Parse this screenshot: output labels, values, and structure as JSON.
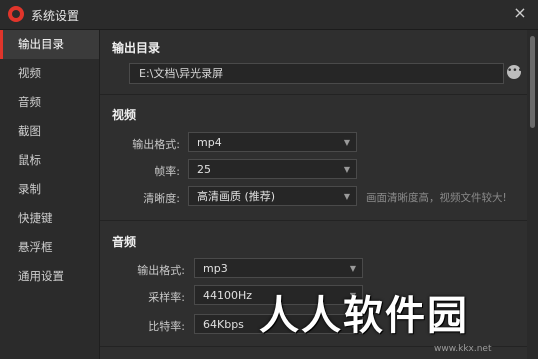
{
  "window": {
    "title": "系统设置",
    "close_icon": "×"
  },
  "sidebar": {
    "items": [
      {
        "label": "输出目录"
      },
      {
        "label": "视频"
      },
      {
        "label": "音频"
      },
      {
        "label": "截图"
      },
      {
        "label": "鼠标"
      },
      {
        "label": "录制"
      },
      {
        "label": "快捷键"
      },
      {
        "label": "悬浮框"
      },
      {
        "label": "通用设置"
      }
    ]
  },
  "output_dir": {
    "title": "输出目录",
    "path": "E:\\文档\\异光录屏",
    "more_icon": "•••"
  },
  "video": {
    "title": "视频",
    "format_label": "输出格式:",
    "format_value": "mp4",
    "fps_label": "帧率:",
    "fps_value": "25",
    "quality_label": "清晰度:",
    "quality_value": "高清画质 (推荐)",
    "quality_hint": "画面清晰度高，视频文件较大!"
  },
  "audio": {
    "title": "音频",
    "format_label": "输出格式:",
    "format_value": "mp3",
    "sample_label": "采样率:",
    "sample_value": "44100Hz",
    "bitrate_label": "比特率:",
    "bitrate_value": "64Kbps"
  },
  "caret_icon": "▼",
  "watermark": {
    "text": "人人软件园",
    "url": "www.kkx.net"
  },
  "colors": {
    "accent": "#e0352b",
    "background": "#2f2f2f",
    "sidebar": "#2b2b2b"
  }
}
